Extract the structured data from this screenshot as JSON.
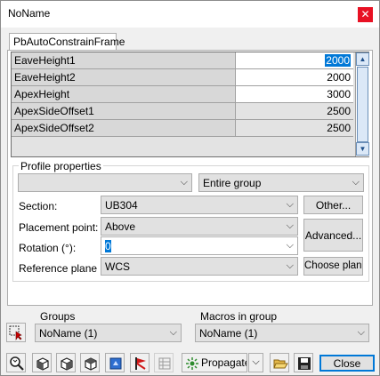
{
  "window": {
    "title": "NoName",
    "close_glyph": "✕"
  },
  "tab": {
    "label": "PbAutoConstrainFrame"
  },
  "grid": {
    "rows": [
      {
        "name": "EaveHeight1",
        "value": "2000"
      },
      {
        "name": "EaveHeight2",
        "value": "2000"
      },
      {
        "name": "ApexHeight",
        "value": "3000"
      },
      {
        "name": "ApexSideOffset1",
        "value": "2500"
      },
      {
        "name": "ApexSideOffset2",
        "value": "2500"
      }
    ]
  },
  "profile": {
    "group_label": "Profile properties",
    "profile_combo_value": "",
    "scope_value": "Entire group",
    "section_label": "Section:",
    "section_value": "UB304",
    "other_button": "Other...",
    "placement_label": "Placement point:",
    "placement_value": "Above",
    "advanced_button": "Advanced...",
    "rotation_label": "Rotation (°):",
    "rotation_value": "0",
    "refplane_label": "Reference plane",
    "refplane_value": "WCS",
    "choose_plane_button": "Choose plane"
  },
  "groups": {
    "label": "Groups",
    "value": "NoName (1)"
  },
  "macros": {
    "label": "Macros in group",
    "value": "NoName (1)"
  },
  "toolbar": {
    "propagate_label": "Propagate",
    "close_label": "Close",
    "icons": [
      "select-cursor-icon",
      "zoom-icon",
      "cube-1-icon",
      "cube-2-icon",
      "cube-3-icon",
      "blue-box-icon",
      "red-flag-icon",
      "table-icon",
      "propagate-icon",
      "chevron-down-icon",
      "folder-open-icon",
      "save-icon"
    ]
  },
  "colors": {
    "selection": "#0078d7",
    "close_red": "#e81123",
    "scroll_blue": "#dbe8f7"
  }
}
